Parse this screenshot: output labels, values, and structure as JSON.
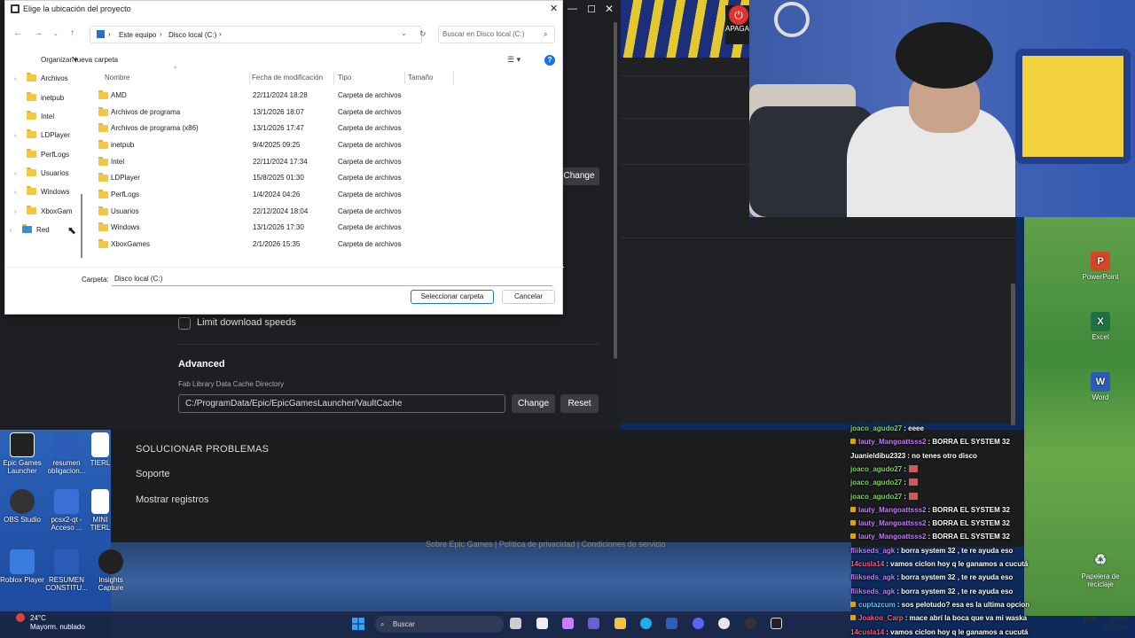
{
  "dialog": {
    "title": "Elige la ubicación del proyecto",
    "address": {
      "root": "Este equipo",
      "sep": "›",
      "current": "Disco local (C:)"
    },
    "search_placeholder": "Buscar en Disco local (C:)",
    "toolbar": {
      "organize": "Organizar ▾",
      "new_folder": "Nueva carpeta"
    },
    "nav_tree": [
      "Archivos",
      "inetpub",
      "Intel",
      "LDPlayer",
      "PerfLogs",
      "Usuarios",
      "Windows",
      "XboxGam",
      "Red"
    ],
    "columns": {
      "name": "Nombre",
      "date": "Fecha de modificación",
      "type": "Tipo",
      "size": "Tamaño"
    },
    "rows": [
      {
        "name": "AMD",
        "date": "22/11/2024 18:28",
        "type": "Carpeta de archivos"
      },
      {
        "name": "Archivos de programa",
        "date": "13/1/2026 18:07",
        "type": "Carpeta de archivos"
      },
      {
        "name": "Archivos de programa (x86)",
        "date": "13/1/2026 17:47",
        "type": "Carpeta de archivos"
      },
      {
        "name": "inetpub",
        "date": "9/4/2025 09:25",
        "type": "Carpeta de archivos"
      },
      {
        "name": "Intel",
        "date": "22/11/2024 17:34",
        "type": "Carpeta de archivos"
      },
      {
        "name": "LDPlayer",
        "date": "15/8/2025 01:30",
        "type": "Carpeta de archivos"
      },
      {
        "name": "PerfLogs",
        "date": "1/4/2024 04:26",
        "type": "Carpeta de archivos"
      },
      {
        "name": "Usuarios",
        "date": "22/12/2024 18:04",
        "type": "Carpeta de archivos"
      },
      {
        "name": "Windows",
        "date": "13/1/2026 17:30",
        "type": "Carpeta de archivos"
      },
      {
        "name": "XboxGames",
        "date": "2/1/2026 15:35",
        "type": "Carpeta de archivos"
      }
    ],
    "folder_label": "Carpeta:",
    "folder_value": "Disco local (C:)",
    "select_button": "Seleccionar carpeta",
    "cancel_button": "Cancelar"
  },
  "epic": {
    "change_top": "Change",
    "limit_download": "Limit download speeds",
    "advanced": "Advanced",
    "cache_label": "Fab Library Data Cache Directory",
    "cache_value": "C:/ProgramData/Epic/EpicGamesLauncher/VaultCache",
    "change": "Change",
    "reset": "Reset",
    "troubleshoot": "SOLUCIONAR PROBLEMAS",
    "support": "Soporte",
    "logs": "Mostrar registros",
    "footer": "Sobre Epic Games | Política de privacidad | Condiciones de servicio"
  },
  "overlay": {
    "apagar": "APAGAR"
  },
  "chat": [
    {
      "user": "joaco_agudo27",
      "color": "#7fd45a",
      "badge": false,
      "text": ": eeee"
    },
    {
      "user": "lauty_Mangoattsss2",
      "color": "#c57bff",
      "badge": true,
      "text": ": BORRA EL SYSTEM 32"
    },
    {
      "user": "Juanieldibu2323",
      "color": "#ffffff",
      "badge": false,
      "text": ": no tenes otro disco"
    },
    {
      "user": "joaco_agudo27",
      "color": "#7fd45a",
      "badge": false,
      "text": ":",
      "emote": true
    },
    {
      "user": "joaco_agudo27",
      "color": "#7fd45a",
      "badge": false,
      "text": ":",
      "emote": true
    },
    {
      "user": "joaco_agudo27",
      "color": "#7fd45a",
      "badge": false,
      "text": ":",
      "emote": true
    },
    {
      "user": "lauty_Mangoattsss2",
      "color": "#c57bff",
      "badge": true,
      "text": ": BORRA EL SYSTEM 32"
    },
    {
      "user": "lauty_Mangoattsss2",
      "color": "#c57bff",
      "badge": true,
      "text": ": BORRA EL SYSTEM 32"
    },
    {
      "user": "lauty_Mangoattsss2",
      "color": "#c57bff",
      "badge": true,
      "text": ": BORRA EL SYSTEM 32"
    },
    {
      "user": "fliikseds_agk",
      "color": "#c57bff",
      "badge": false,
      "text": ": borra system 32 , te re ayuda eso"
    },
    {
      "user": "14cusla14",
      "color": "#ff5a7a",
      "badge": false,
      "text": ": vamos ciclon hoy q le ganamos a cucutá"
    },
    {
      "user": "fliikseds_agk",
      "color": "#c57bff",
      "badge": false,
      "text": ": borra system 32 , te re ayuda eso"
    },
    {
      "user": "fliikseds_agk",
      "color": "#c57bff",
      "badge": false,
      "text": ": borra system 32 , te re ayuda eso"
    },
    {
      "user": "cuptazcum",
      "color": "#4fd0ff",
      "badge": true,
      "text": ": sos pelotudo? esa es la ultima opcion"
    },
    {
      "user": "Joakoo_Carp",
      "color": "#ff5a7a",
      "badge": true,
      "text": ": mace abrí la boca que va mi waska"
    },
    {
      "user": "14cusla14",
      "color": "#ff5a7a",
      "badge": false,
      "text": ": vamos ciclon hoy q le ganamos a cucutá"
    }
  ],
  "desktop_left": [
    {
      "label": "Epic Games Launcher",
      "color": "#222222"
    },
    {
      "label": "resumen obligacion...",
      "color": "#2b5cb8"
    },
    {
      "label": "TIERL",
      "color": "#ffffff"
    },
    {
      "label": "OBS Studio",
      "color": "#333333"
    },
    {
      "label": "pcsx2-qt - Acceso ...",
      "color": "#3a6fd8"
    },
    {
      "label": "MINI TIERL",
      "color": "#ffffff"
    },
    {
      "label": "Roblox Player",
      "color": "#3a7be0"
    },
    {
      "label": "RESUMEN CONSTITU...",
      "color": "#2b5cb8"
    },
    {
      "label": "Insights Capture",
      "color": "#222222"
    }
  ],
  "desktop_right": [
    {
      "label": "PowerPoint",
      "letter": "P",
      "color": "#d24726"
    },
    {
      "label": "Excel",
      "letter": "X",
      "color": "#1e7145"
    },
    {
      "label": "Word",
      "letter": "W",
      "color": "#2b5cb8"
    },
    {
      "label": "Papelera de reciclaje",
      "letter": "♻",
      "color": "#8fb8d8"
    }
  ],
  "taskbar": {
    "temp": "24°C",
    "weather": "Mayorm. nublado",
    "search": "Buscar",
    "time": "00:26",
    "date": "14/1/2026",
    "lang": "ESP"
  }
}
